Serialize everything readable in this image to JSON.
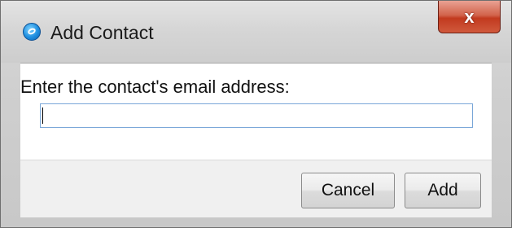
{
  "window": {
    "title": "Add Contact",
    "app_icon": "app-logo-icon",
    "close_label": "x"
  },
  "form": {
    "prompt": "Enter the contact's email address:",
    "email_value": "",
    "email_placeholder": ""
  },
  "buttons": {
    "cancel_label": "Cancel",
    "add_label": "Add"
  }
}
